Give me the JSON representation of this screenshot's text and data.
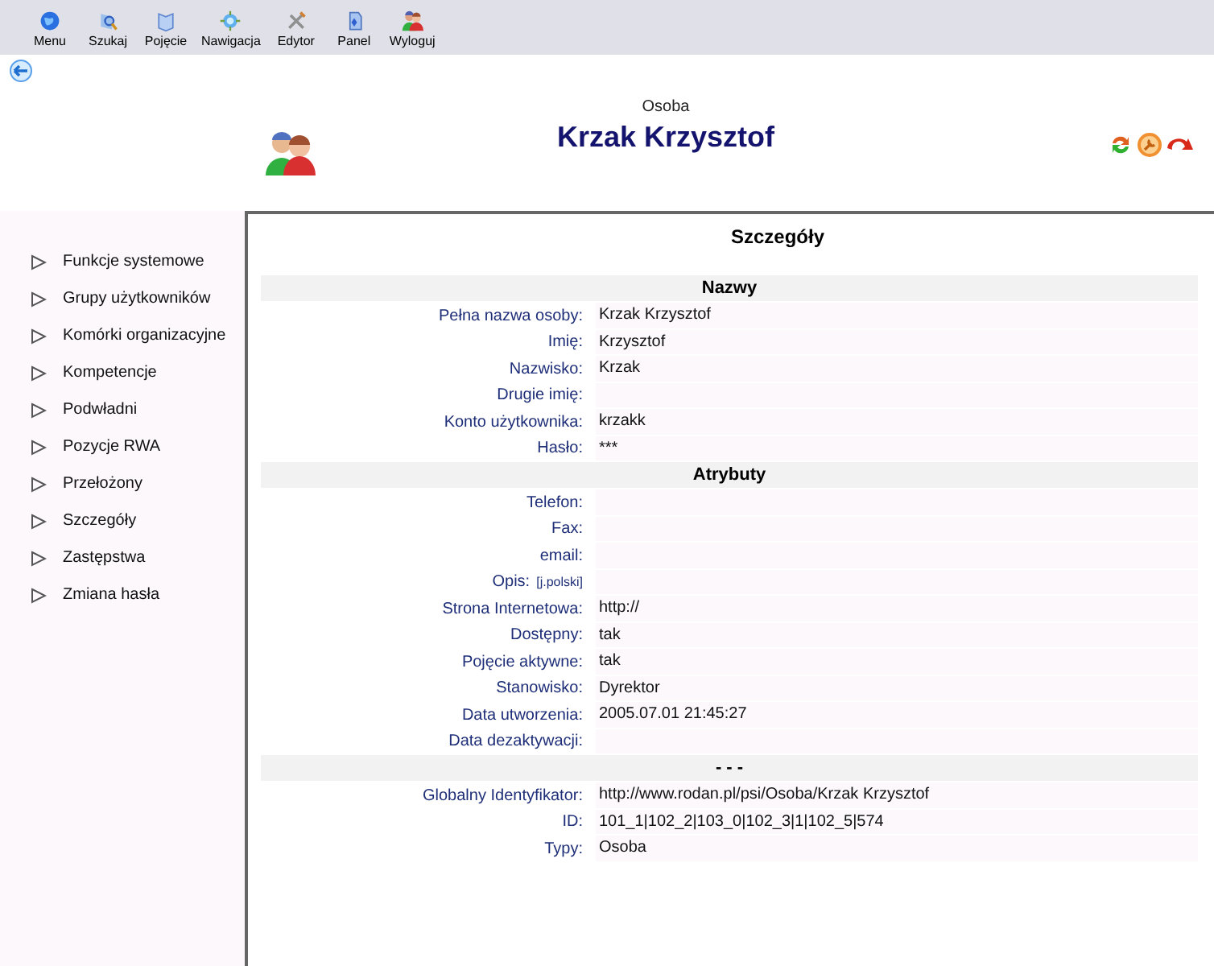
{
  "toolbar": [
    "Menu",
    "Szukaj",
    "Pojęcie",
    "Nawigacja",
    "Edytor",
    "Panel",
    "Wyloguj"
  ],
  "header": {
    "type": "Osoba",
    "name": "Krzak Krzysztof"
  },
  "sidebar": {
    "items": [
      "Funkcje systemowe",
      "Grupy użytkowników",
      "Komórki organizacyjne",
      "Kompetencje",
      "Podwładni",
      "Pozycje RWA",
      "Przełożony",
      "Szczegóły",
      "Zastępstwa",
      "Zmiana hasła"
    ]
  },
  "details": {
    "title": "Szczegóły",
    "sections": [
      {
        "title": "Nazwy",
        "fields": [
          {
            "label": "Pełna nazwa osoby:",
            "value": "Krzak Krzysztof"
          },
          {
            "label": "Imię:",
            "value": "Krzysztof"
          },
          {
            "label": "Nazwisko:",
            "value": "Krzak"
          },
          {
            "label": "Drugie imię:"
          },
          {
            "label": "Konto użytkownika:",
            "value": "krzakk"
          },
          {
            "label": "Hasło:",
            "value": "***"
          }
        ]
      },
      {
        "title": "Atrybuty",
        "fields": [
          {
            "label": "Telefon:"
          },
          {
            "label": "Fax:"
          },
          {
            "label": "email:"
          },
          {
            "label": "Opis:",
            "link": "[j.polski]"
          },
          {
            "label": "Strona Internetowa:",
            "value": "http://"
          },
          {
            "label": "Dostępny:",
            "value": "tak"
          },
          {
            "label": "Pojęcie aktywne:",
            "value": "tak"
          },
          {
            "label": "Stanowisko:",
            "value": "Dyrektor"
          },
          {
            "label": "Data utworzenia:",
            "value": "2005.07.01 21:45:27"
          },
          {
            "label": "Data dezaktywacji:"
          }
        ]
      },
      {
        "title": "- - -",
        "fields": [
          {
            "label": "Globalny Identyfikator:",
            "value": "http://www.rodan.pl/psi/Osoba/Krzak Krzysztof"
          },
          {
            "label": "ID:",
            "value": "101_1|102_2|103_0|102_3|1|102_5|574"
          },
          {
            "label": "Typy:",
            "value": "Osoba"
          }
        ]
      }
    ]
  }
}
